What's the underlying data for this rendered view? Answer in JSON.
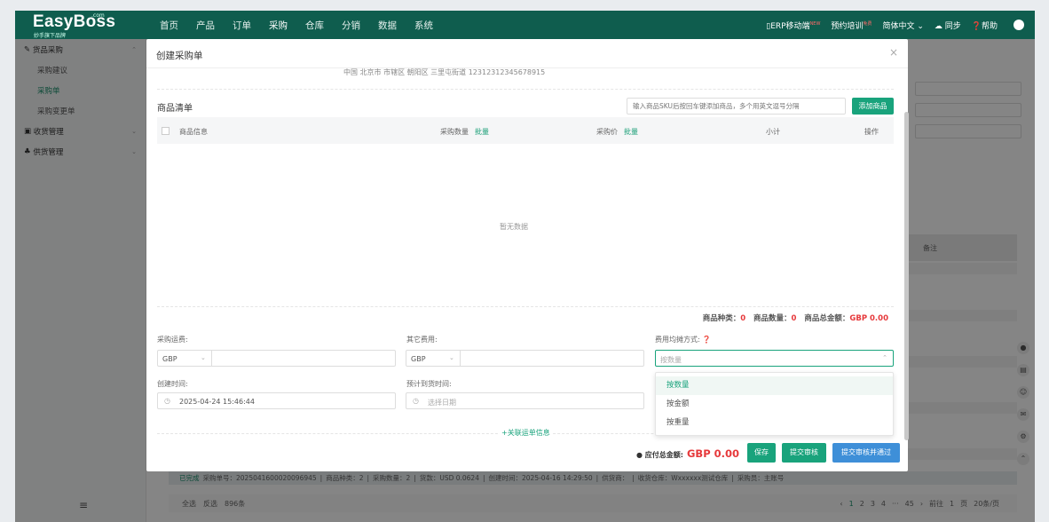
{
  "topnav": {
    "logo": "EasyBoss",
    "logo_com": ".com",
    "logo_sub": "妙手旗下品牌",
    "menu": [
      "首页",
      "产品",
      "订单",
      "采购",
      "仓库",
      "分销",
      "数据",
      "系统"
    ],
    "active_menu": "采购",
    "right": {
      "mobile": "ERP移动端",
      "mobile_badge": "NEW",
      "training": "预约培训",
      "training_badge": "免费",
      "lang": "简体中文",
      "sync": "同步",
      "help": "帮助"
    }
  },
  "sidebar": {
    "items": [
      {
        "label": "货品采购",
        "type": "group",
        "expanded": true
      },
      {
        "label": "采购建议",
        "type": "sub"
      },
      {
        "label": "采购单",
        "type": "sub",
        "active": true
      },
      {
        "label": "采购变更单",
        "type": "sub"
      },
      {
        "label": "收货管理",
        "type": "group"
      },
      {
        "label": "供货管理",
        "type": "group"
      }
    ]
  },
  "background": {
    "remark_col": "备注",
    "info_row": {
      "status": "已完成",
      "po_no": "采购单号：2025041600020096945",
      "kinds": "商品种类：2",
      "qty": "采购数量：2",
      "paid": "货款：USD 0.0624",
      "created": "创建时间：2025-04-16 14:29:50",
      "supplier": "供货商：",
      "warehouse": "收货仓库：Wxxxxxx测试仓库",
      "buyer": "采购员：主账号"
    },
    "footer": {
      "select_all": "全选",
      "invert": "反选",
      "count": "896条",
      "pages": [
        "1",
        "2",
        "3",
        "4",
        "···",
        "45"
      ],
      "goto": "前往",
      "goto_page": "1",
      "page_unit": "页",
      "page_size": "20条/页"
    }
  },
  "modal": {
    "title": "创建采购单",
    "address": "中国 北京市 市辖区 朝阳区 三里屯街道 12312312345678915",
    "section": "商品清单",
    "sku_placeholder": "输入商品SKU后按回车键添加商品，多个用英文逗号分隔",
    "add_btn": "添加商品",
    "table": {
      "col_info": "商品信息",
      "col_qty": "采购数量",
      "col_price": "采购价",
      "batch": "批量",
      "col_subtotal": "小计",
      "col_action": "操作"
    },
    "empty": "暂无数据",
    "summary": {
      "kinds_label": "商品种类：",
      "kinds": "0",
      "qty_label": "商品数量：",
      "qty": "0",
      "total_label": "商品总金额：",
      "total": "GBP 0.00"
    },
    "form": {
      "freight_label": "采购运费:",
      "freight_cur": "GBP",
      "other_label": "其它费用:",
      "other_cur": "GBP",
      "alloc_label": "费用均摊方式:",
      "alloc_placeholder": "按数量",
      "created_label": "创建时间:",
      "created_value": "2025-04-24 15:46:44",
      "eta_label": "预计到货时间:",
      "eta_placeholder": "选择日期"
    },
    "link_ship": "+关联运单信息",
    "footer": {
      "total_label": "应付总金额:",
      "total": "GBP 0.00",
      "save": "保存",
      "submit": "提交审核",
      "submit_approve": "提交审核并通过"
    }
  },
  "dropdown": {
    "options": [
      "按数量",
      "按金额",
      "按重量"
    ],
    "selected": "按数量"
  },
  "colors": {
    "nav": "#0f5d4e",
    "accent": "#19a37c",
    "red": "#e6393b",
    "blue": "#3e8fd8"
  }
}
